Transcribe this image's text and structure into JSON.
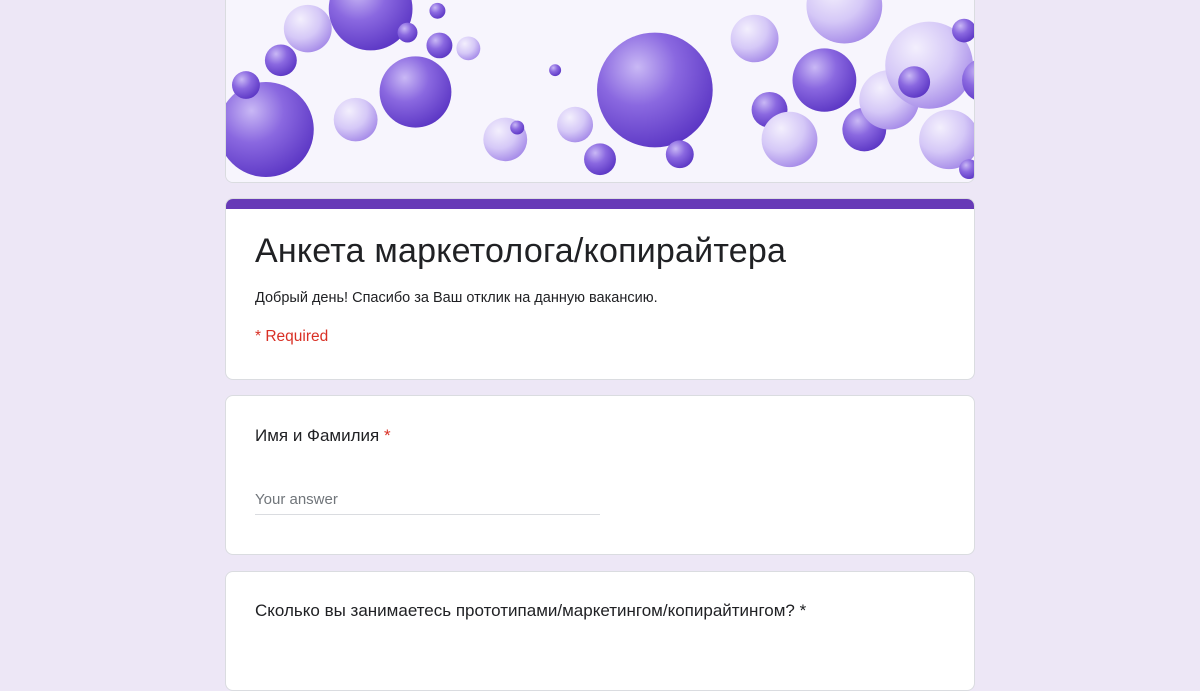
{
  "form": {
    "title": "Анкета маркетолога/копирайтера",
    "description": "Добрый день! Спасибо за Ваш отклик на данную вакансию.",
    "required_note": "* Required",
    "accent_color": "#673ab7",
    "background_color": "#ede7f6",
    "required_color": "#d93025"
  },
  "banner": {
    "theme": "purple-bubbles-header-image"
  },
  "questions": [
    {
      "label": "Имя и Фамилия",
      "required_mark": "*",
      "placeholder": "Your answer",
      "value": ""
    },
    {
      "label": "Сколько вы занимаетесь прототипами/маркетингом/копирайтингом?",
      "required_mark": "*"
    }
  ]
}
